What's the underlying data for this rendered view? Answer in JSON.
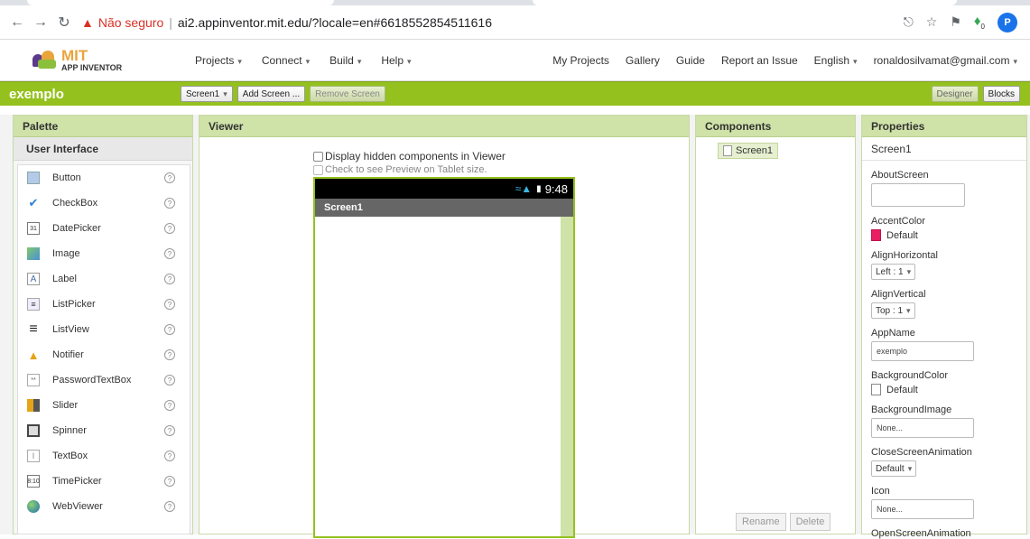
{
  "browser": {
    "security_label": "Não seguro",
    "url": "ai2.appinventor.mit.edu/?locale=en#6618552854511616",
    "profile_initial": "P",
    "extension_badge": "0"
  },
  "header": {
    "logo_main": "MIT",
    "logo_sub": "APP INVENTOR",
    "menus": [
      "Projects",
      "Connect",
      "Build",
      "Help"
    ],
    "right_links": [
      "My Projects",
      "Gallery",
      "Guide",
      "Report an Issue"
    ],
    "language": "English",
    "account": "ronaldosilvamat@gmail.com"
  },
  "project": {
    "name": "exemplo",
    "screen_select": "Screen1",
    "add_screen": "Add Screen ...",
    "remove_screen": "Remove Screen",
    "designer": "Designer",
    "blocks": "Blocks"
  },
  "palette": {
    "title": "Palette",
    "section": "User Interface",
    "items": [
      {
        "label": "Button",
        "icon": "button-icon"
      },
      {
        "label": "CheckBox",
        "icon": "checkbox-icon"
      },
      {
        "label": "DatePicker",
        "icon": "datepicker-icon"
      },
      {
        "label": "Image",
        "icon": "image-icon"
      },
      {
        "label": "Label",
        "icon": "label-icon"
      },
      {
        "label": "ListPicker",
        "icon": "listpicker-icon"
      },
      {
        "label": "ListView",
        "icon": "listview-icon"
      },
      {
        "label": "Notifier",
        "icon": "notifier-icon"
      },
      {
        "label": "PasswordTextBox",
        "icon": "passwordtextbox-icon"
      },
      {
        "label": "Slider",
        "icon": "slider-icon"
      },
      {
        "label": "Spinner",
        "icon": "spinner-icon"
      },
      {
        "label": "TextBox",
        "icon": "textbox-icon"
      },
      {
        "label": "TimePicker",
        "icon": "timepicker-icon"
      },
      {
        "label": "WebViewer",
        "icon": "webviewer-icon"
      }
    ],
    "help_glyph": "?"
  },
  "viewer": {
    "title": "Viewer",
    "hidden_components": "Display hidden components in Viewer",
    "tablet_preview": "Check to see Preview on Tablet size.",
    "phone_time": "9:48",
    "phone_screen_title": "Screen1"
  },
  "components": {
    "title": "Components",
    "root": "Screen1",
    "rename": "Rename",
    "delete": "Delete"
  },
  "properties": {
    "title": "Properties",
    "screen": "Screen1",
    "about_screen": "AboutScreen",
    "accent_color": "AccentColor",
    "accent_value": "Default",
    "accent_swatch": "#e91e63",
    "align_horizontal": "AlignHorizontal",
    "align_horizontal_value": "Left : 1",
    "align_vertical": "AlignVertical",
    "align_vertical_value": "Top : 1",
    "app_name": "AppName",
    "app_name_value": "exemplo",
    "background_color": "BackgroundColor",
    "background_value": "Default",
    "background_image": "BackgroundImage",
    "background_image_value": "None...",
    "close_screen_animation": "CloseScreenAnimation",
    "close_screen_animation_value": "Default",
    "icon": "Icon",
    "icon_value": "None...",
    "open_screen_animation": "OpenScreenAnimation"
  },
  "colors": {
    "green_bar": "#95c11f",
    "panel_header": "#cfe2a8",
    "warning": "#d93025"
  }
}
